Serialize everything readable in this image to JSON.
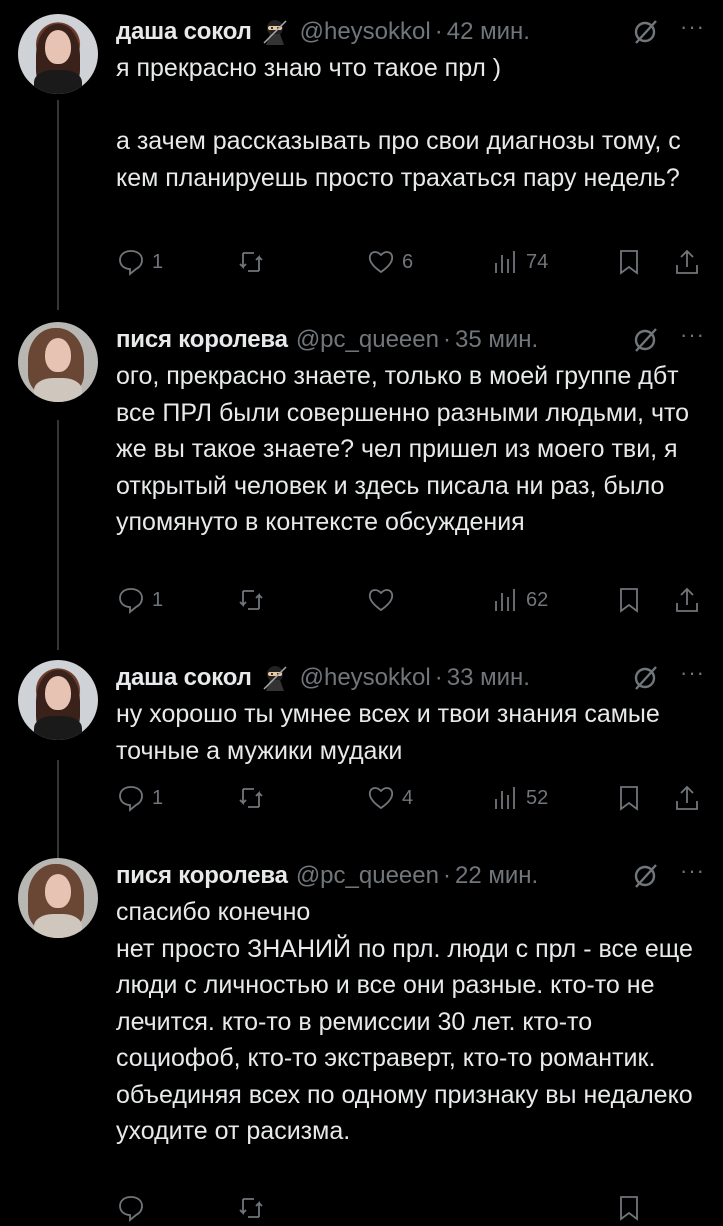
{
  "tweets": [
    {
      "name": "даша сокол",
      "handle": "@heysokkol",
      "dot": "·",
      "time": "42 мин.",
      "avatar": "dasha",
      "has_emoji": true,
      "text": "я прекрасно знаю что такое прл )\n\nа зачем рассказывать про свои диагнозы тому, с кем планируешь просто трахаться пару недель?",
      "replies": "1",
      "retweets": "",
      "likes": "6",
      "views": "74"
    },
    {
      "name": "пися королева",
      "handle": "@pc_queeen",
      "dot": "·",
      "time": "35 мин.",
      "avatar": "pisya",
      "has_emoji": false,
      "text": "ого, прекрасно знаете, только в моей группе дбт все ПРЛ были совершенно разными людьми, что же вы такое знаете? чел пришел из моего тви, я открытый человек и здесь писала ни раз, было упомянуто в контексте обсуждения",
      "replies": "1",
      "retweets": "",
      "likes": "",
      "views": "62"
    },
    {
      "name": "даша сокол",
      "handle": "@heysokkol",
      "dot": "·",
      "time": "33 мин.",
      "avatar": "dasha",
      "has_emoji": true,
      "text": "ну хорошо ты умнее всех и твои знания самые точные а мужики мудаки",
      "replies": "1",
      "retweets": "",
      "likes": "4",
      "views": "52"
    },
    {
      "name": "пися королева",
      "handle": "@pc_queeen",
      "dot": "·",
      "time": "22 мин.",
      "avatar": "pisya",
      "has_emoji": false,
      "text": "спасибо конечно\nнет просто ЗНАНИЙ по прл. люди с прл - все еще люди с личностью и все они разные. кто-то не лечится. кто-то в ремиссии 30 лет. кто-то социофоб, кто-то экстраверт, кто-то романтик. объединяя всех по одному признаку вы недалеко уходите от расизма.",
      "replies": "",
      "retweets": "",
      "likes": "",
      "views": ""
    }
  ],
  "icons": {
    "reply": "reply-icon",
    "retweet": "retweet-icon",
    "like": "heart-icon",
    "views": "views-icon",
    "bookmark": "bookmark-icon",
    "share": "share-icon",
    "grok": "grok-icon",
    "more": "more-icon",
    "emoji": "ninja-emoji-icon"
  },
  "more_glyph": "···",
  "colors": {
    "background": "#000000",
    "text": "#e7e9ea",
    "muted": "#71767b",
    "line": "#333639"
  }
}
